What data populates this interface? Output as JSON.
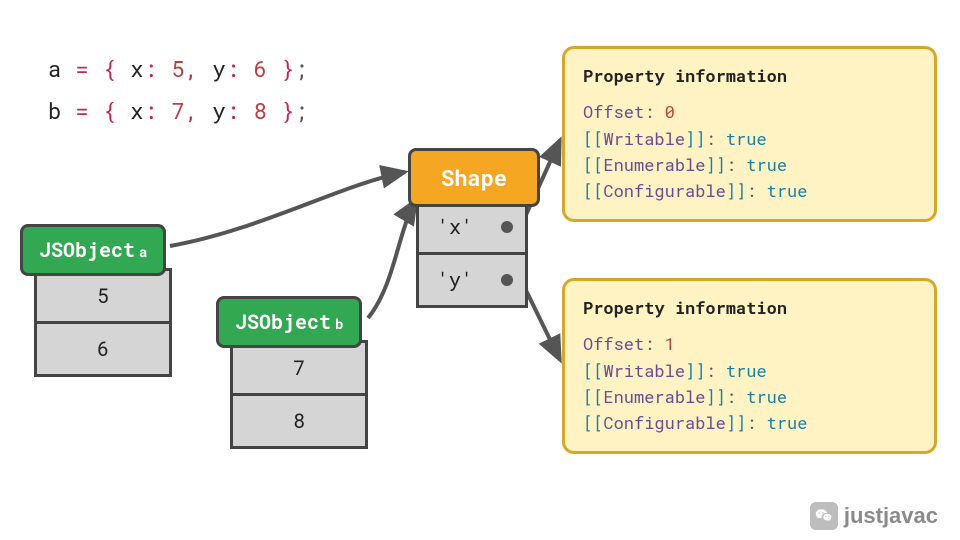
{
  "code": {
    "lines": [
      {
        "var": "a",
        "x_val": "5",
        "y_val": "6"
      },
      {
        "var": "b",
        "x_val": "7",
        "y_val": "8"
      }
    ]
  },
  "js_objects": [
    {
      "label": "JSObject",
      "sub": "a",
      "values": [
        "5",
        "6"
      ]
    },
    {
      "label": "JSObject",
      "sub": "b",
      "values": [
        "7",
        "8"
      ]
    }
  ],
  "shape": {
    "label": "Shape",
    "slots": [
      "'x'",
      "'y'"
    ]
  },
  "property_info": [
    {
      "title": "Property information",
      "offset_label": "Offset",
      "offset_val": "0",
      "attrs": [
        {
          "name": "Writable",
          "val": "true"
        },
        {
          "name": "Enumerable",
          "val": "true"
        },
        {
          "name": "Configurable",
          "val": "true"
        }
      ]
    },
    {
      "title": "Property information",
      "offset_label": "Offset",
      "offset_val": "1",
      "attrs": [
        {
          "name": "Writable",
          "val": "true"
        },
        {
          "name": "Enumerable",
          "val": "true"
        },
        {
          "name": "Configurable",
          "val": "true"
        }
      ]
    }
  ],
  "watermark": "justjavac"
}
